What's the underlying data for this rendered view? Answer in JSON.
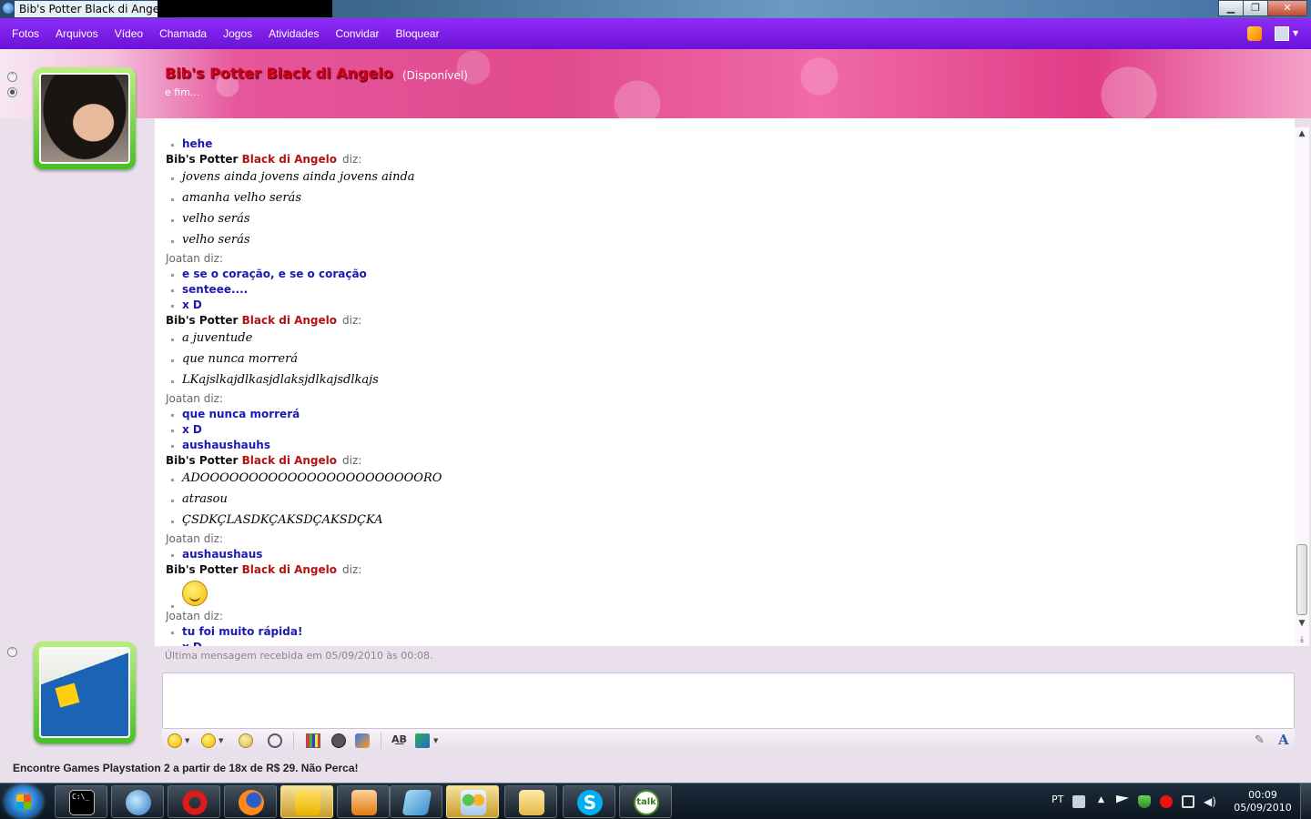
{
  "window": {
    "title": "Bib's Potter Black di Angelo",
    "controls": {
      "minimize": "▁",
      "maximize": "❐",
      "close": "✕"
    }
  },
  "menu": [
    "Fotos",
    "Arquivos",
    "Vídeo",
    "Chamada",
    "Jogos",
    "Atividades",
    "Convidar",
    "Bloquear"
  ],
  "contact": {
    "display_name": "Bib's Potter Black di Angelo",
    "status": "(Disponível)",
    "personal_message": "e fim..."
  },
  "conversation": [
    {
      "sender": "Joatan",
      "messages": [
        "hehe"
      ]
    },
    {
      "sender": "Bib",
      "messages": [
        "jovens ainda jovens ainda jovens ainda",
        "amanha velho serás",
        "velho serás",
        "velho serás"
      ]
    },
    {
      "sender": "Joatan",
      "messages": [
        "e se o coração, e se o coração",
        "senteee....",
        "x D"
      ]
    },
    {
      "sender": "Bib",
      "messages": [
        "a juventude",
        "que nunca morrerá",
        "LKajslkajdlkasjdlaksjdlkajsdlkajs"
      ]
    },
    {
      "sender": "Joatan",
      "messages": [
        "que nunca morrerá",
        "x D",
        "aushaushauhs"
      ]
    },
    {
      "sender": "Bib",
      "messages": [
        "ADOOOOOOOOOOOOOOOOOOOOOOORO",
        "atrasou",
        "ÇSDKÇLASDKÇAKSDÇAKSDÇKA"
      ]
    },
    {
      "sender": "Joatan",
      "messages": [
        "aushaushaus"
      ]
    },
    {
      "sender": "Bib",
      "messages": [
        ":emoticon:"
      ]
    },
    {
      "sender": "Joatan",
      "messages": [
        "tu foi muito rápida!",
        "x D"
      ]
    }
  ],
  "senders": {
    "bib": {
      "part1": "Bib's Potter ",
      "part2": "Black di Angelo",
      "diz": "diz:"
    },
    "joatan": {
      "label": "Joatan diz:"
    }
  },
  "last_message": "Última mensagem recebida em 05/09/2010 às 00:08.",
  "input": {
    "value": ""
  },
  "toolbar": {
    "icons": [
      "emoticon-icon",
      "wink-icon",
      "voice-clip-icon",
      "nudge-icon",
      "background-icon",
      "wink-animation-icon",
      "games-icon",
      "font-icon",
      "color-icon",
      "pen-icon",
      "text-format-icon"
    ],
    "font_label": "A͟B",
    "text_format_label": "A",
    "pen_label": "✎"
  },
  "ad": "Encontre Games Playstation 2 a partir de 18x de R$ 29. Não Perca!",
  "taskbar": {
    "apps": [
      "cmd",
      "Windows Live Messenger",
      "Opera",
      "Firefox",
      "Bird app",
      "Media Player",
      "Notes",
      "Windows Live Contacts",
      "Windows Explorer",
      "Skype",
      "Google Talk"
    ],
    "cmd_label": "C:\\_",
    "skype_label": "S",
    "talk_label": "talk",
    "language": "PT",
    "time": "00:09",
    "date": "05/09/2010"
  },
  "colors": {
    "menubar": "#7a1ce6",
    "bib_name_accent": "#b31212",
    "joatan_message": "#1a1ab0",
    "avatar_frame": "#46c21f"
  }
}
